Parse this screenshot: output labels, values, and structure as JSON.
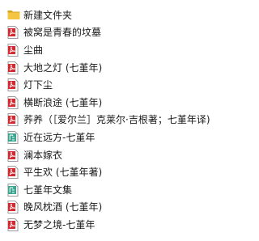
{
  "colors": {
    "folder": "#f4c542",
    "folder_dark": "#d9a21b",
    "pdf": "#d7282f",
    "epub": "#3aa58f"
  },
  "files": [
    {
      "name": "新建文件夹",
      "icon": "folder-icon"
    },
    {
      "name": "被窝是青春的坟墓",
      "icon": "pdf-file-icon"
    },
    {
      "name": "尘曲",
      "icon": "pdf-file-icon"
    },
    {
      "name": "大地之灯 (七堇年)",
      "icon": "pdf-file-icon"
    },
    {
      "name": "灯下尘",
      "icon": "pdf-file-icon"
    },
    {
      "name": "横断浪途 (七堇年)",
      "icon": "pdf-file-icon"
    },
    {
      "name": "荞养（［爱尔兰］克莱尔·吉根著；七堇年译)",
      "icon": "pdf-file-icon"
    },
    {
      "name": "近在远方-七堇年",
      "icon": "epub-file-icon"
    },
    {
      "name": "澜本嫁衣",
      "icon": "pdf-file-icon"
    },
    {
      "name": "平生欢 (七堇年著)",
      "icon": "pdf-file-icon"
    },
    {
      "name": "七堇年文集",
      "icon": "epub-file-icon"
    },
    {
      "name": "晚风枕酒 (七堇年)",
      "icon": "pdf-file-icon"
    },
    {
      "name": "无梦之境-七堇年",
      "icon": "pdf-file-icon"
    }
  ]
}
